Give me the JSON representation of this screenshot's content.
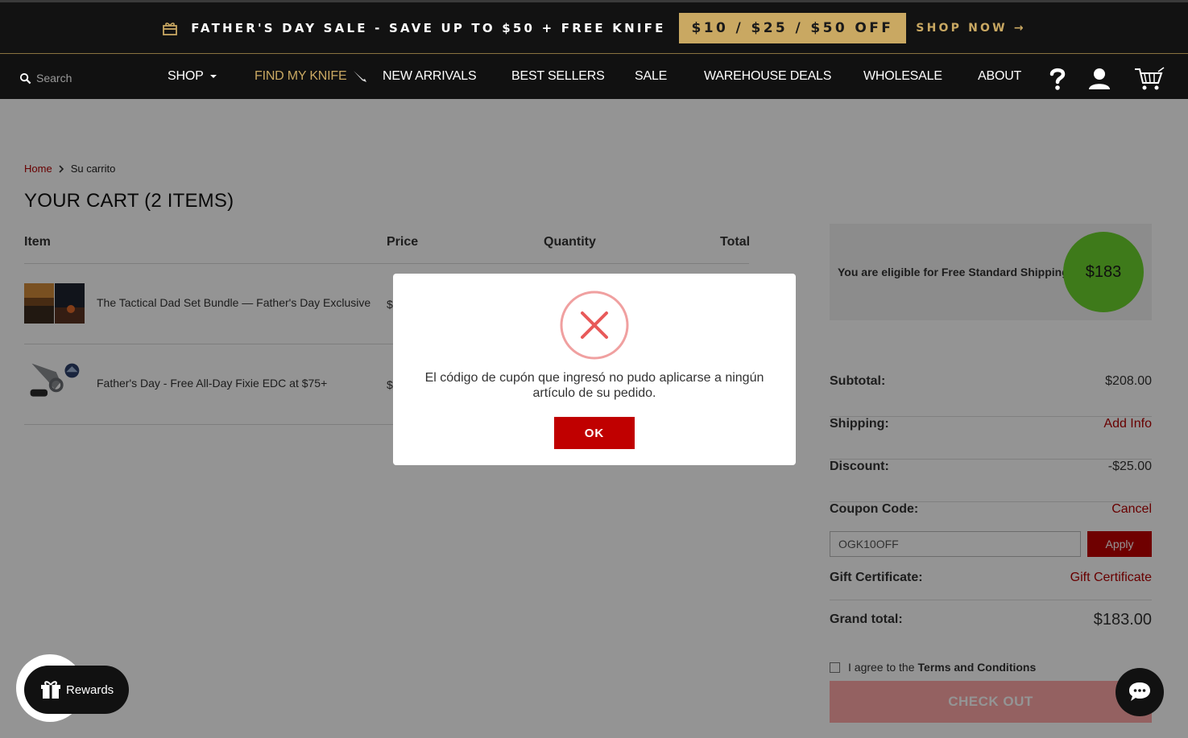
{
  "promo": {
    "text": "FATHER'S DAY SALE - SAVE UP TO $50 + FREE KNIFE",
    "badge": "$10 / $25 / $50 OFF",
    "link": "SHOP NOW →"
  },
  "nav": {
    "search_placeholder": "Search",
    "items": [
      "SHOP",
      "FIND MY KNIFE",
      "NEW ARRIVALS",
      "BEST SELLERS",
      "SALE",
      "WAREHOUSE DEALS",
      "WHOLESALE",
      "ABOUT"
    ],
    "highlight_color": "#c9a862"
  },
  "breadcrumb": {
    "home": "Home",
    "current": "Su carrito"
  },
  "cart": {
    "title": "YOUR CART (2 ITEMS)",
    "columns": [
      "Item",
      "Price",
      "Quantity",
      "Total"
    ],
    "items": [
      {
        "name": "The Tactical Dad Set Bundle — Father's Day Exclusive",
        "price_visible": "$"
      },
      {
        "name": "Father's Day - Free All-Day Fixie EDC at $75+",
        "price_visible": "$"
      }
    ]
  },
  "summary": {
    "shipping_banner": "You are eligible for Free Standard Shipping",
    "shipping_amount": "$183",
    "subtotal_label": "Subtotal:",
    "subtotal": "$208.00",
    "shipping_label": "Shipping:",
    "shipping_action": "Add Info",
    "discount_label": "Discount:",
    "discount": "-$25.00",
    "coupon_label": "Coupon Code:",
    "coupon_action": "Cancel",
    "coupon_value": "OGK10OFF",
    "apply_label": "Apply",
    "gift_label": "Gift Certificate:",
    "gift_action": "Gift Certificate",
    "grand_label": "Grand total:",
    "grand_total": "$183.00",
    "agree_text": "I agree to the",
    "terms_link": "Terms and Conditions",
    "checkout_label": "CHECK OUT"
  },
  "modal": {
    "message": "El código de cupón que ingresó no pudo aplicarse a ningún artículo de su pedido.",
    "ok_label": "OK"
  },
  "widgets": {
    "rewards_label": "Rewards"
  },
  "colors": {
    "accent_red": "#c00000",
    "gold": "#c9a862",
    "shipping_green": "#6cd22e"
  }
}
